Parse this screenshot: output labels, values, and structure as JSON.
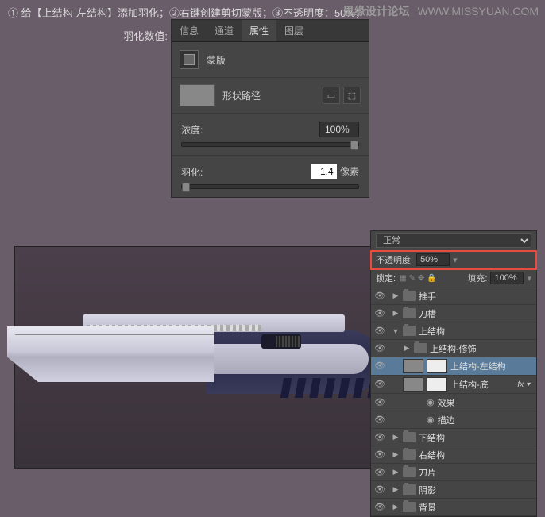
{
  "instruction": "① 给【上结构-左结构】添加羽化；②右键创建剪切蒙版；③不透明度：50%；",
  "feather_label": "羽化数值:",
  "watermark": {
    "name": "思缘设计论坛",
    "url": "WWW.MISSYUAN.COM"
  },
  "tabs": {
    "info": "信息",
    "channel": "通道",
    "props": "属性",
    "layers": "图层"
  },
  "mask": {
    "label": "蒙版"
  },
  "shape": {
    "label": "形状路径"
  },
  "density": {
    "label": "浓度:",
    "value": "100%"
  },
  "feather": {
    "label": "羽化:",
    "value": "1.4",
    "unit": "像素"
  },
  "blend": {
    "mode": "正常",
    "opacity_label": "不透明度:",
    "opacity": "50%"
  },
  "lock": {
    "label": "锁定:",
    "fill_label": "填充:",
    "fill": "100%"
  },
  "layers_list": [
    {
      "name": "推手",
      "type": "folder",
      "indent": 0
    },
    {
      "name": "刀槽",
      "type": "folder",
      "indent": 0
    },
    {
      "name": "上结构",
      "type": "folder",
      "indent": 0,
      "open": true
    },
    {
      "name": "上结构-修饰",
      "type": "folder",
      "indent": 1
    },
    {
      "name": "上结构-左结构",
      "type": "layer",
      "indent": 1,
      "sel": true
    },
    {
      "name": "上结构-底",
      "type": "layer",
      "indent": 1,
      "fx": true
    },
    {
      "name": "效果",
      "type": "fx",
      "indent": 2
    },
    {
      "name": "描边",
      "type": "fx",
      "indent": 2
    },
    {
      "name": "下结构",
      "type": "folder",
      "indent": 0
    },
    {
      "name": "右结构",
      "type": "folder",
      "indent": 0
    },
    {
      "name": "刀片",
      "type": "folder",
      "indent": 0
    },
    {
      "name": "阴影",
      "type": "folder",
      "indent": 0
    },
    {
      "name": "背景",
      "type": "folder",
      "indent": 0
    }
  ]
}
